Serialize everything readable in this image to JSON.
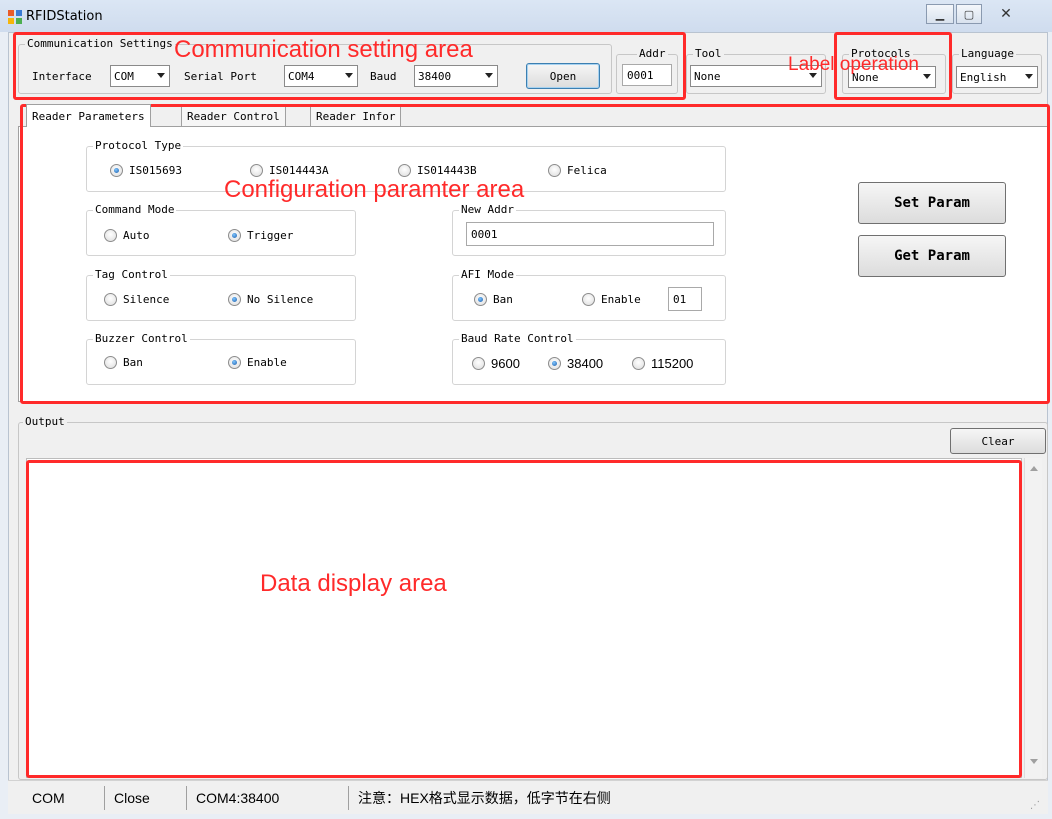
{
  "window": {
    "title": "RFIDStation"
  },
  "communication": {
    "legend": "Communication Settings",
    "interface_label": "Interface",
    "interface_value": "COM",
    "serial_port_label": "Serial Port",
    "serial_port_value": "COM4",
    "baud_label": "Baud",
    "baud_value": "38400",
    "open_label": "Open"
  },
  "addr": {
    "legend": "Addr",
    "value": "0001"
  },
  "tool": {
    "legend": "Tool",
    "value": "None"
  },
  "protocols": {
    "legend": "Protocols",
    "value": "None"
  },
  "language": {
    "legend": "Language",
    "value": "English"
  },
  "tabs": [
    {
      "label": "Reader Parameters"
    },
    {
      "label": "Reader Control"
    },
    {
      "label": "Reader Infor"
    }
  ],
  "params": {
    "protocol_type": {
      "legend": "Protocol Type",
      "options": [
        "IS015693",
        "IS014443A",
        "IS014443B",
        "Felica"
      ],
      "selected": "IS015693"
    },
    "command_mode": {
      "legend": "Command Mode",
      "options": [
        "Auto",
        "Trigger"
      ],
      "selected": "Trigger"
    },
    "tag_control": {
      "legend": "Tag Control",
      "options": [
        "Silence",
        "No Silence"
      ],
      "selected": "No Silence"
    },
    "buzzer_control": {
      "legend": "Buzzer Control",
      "options": [
        "Ban",
        "Enable"
      ],
      "selected": "Enable"
    },
    "new_addr": {
      "legend": "New Addr",
      "value": "0001"
    },
    "afi_mode": {
      "legend": "AFI Mode",
      "options": [
        "Ban",
        "Enable"
      ],
      "selected": "Ban",
      "afi_value": "01"
    },
    "baud_rate_control": {
      "legend": "Baud Rate Control",
      "options": [
        "9600",
        "38400",
        "115200"
      ],
      "selected": "38400"
    },
    "set_param_label": "Set Param",
    "get_param_label": "Get Param"
  },
  "output": {
    "legend": "Output",
    "clear_label": "Clear"
  },
  "annotations": {
    "communication": "Communication setting area",
    "label_operation": "Label operation",
    "configuration": "Configuration paramter area",
    "data_display": "Data display area"
  },
  "status": {
    "interface": "COM",
    "state": "Close",
    "port_baud": "COM4:38400",
    "note": "注意：HEX格式显示数据，低字节在右侧"
  },
  "colors": {
    "annotation": "#ff2a2a",
    "titlebar": "#dbe6f4",
    "radio_selected": "#1a5aa8"
  }
}
